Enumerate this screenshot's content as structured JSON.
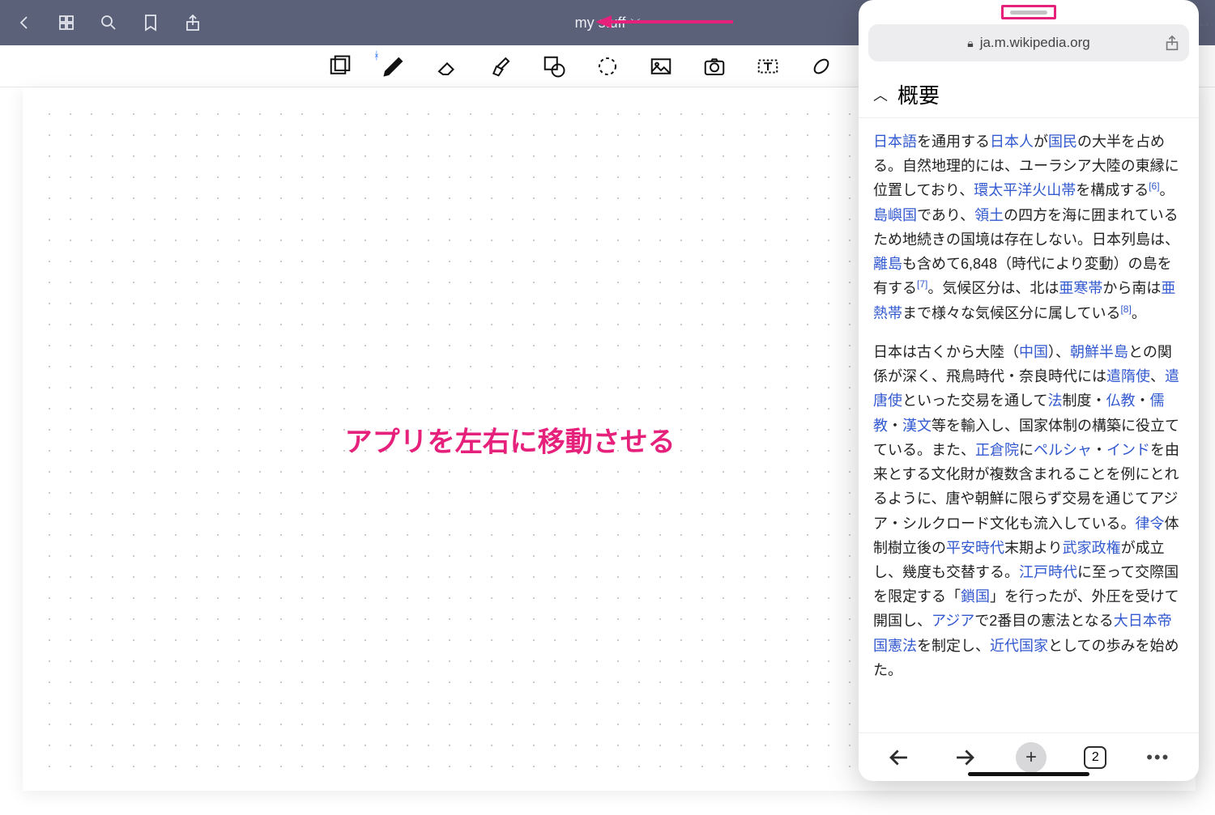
{
  "title": "my stuff",
  "annotation": "アプリを左右に移動させる",
  "slide_over": {
    "url_display": "ja.m.wikipedia.org",
    "section_heading": "概要",
    "tab_count": "2",
    "paragraphs": [
      [
        {
          "t": "日本語",
          "l": true
        },
        {
          "t": "を通用する"
        },
        {
          "t": "日本人",
          "l": true
        },
        {
          "t": "が"
        },
        {
          "t": "国民",
          "l": true
        },
        {
          "t": "の大半を占める。自然地理的には、ユーラシア大陸の東縁に位置しており、"
        },
        {
          "t": "環太平洋火山帯",
          "l": true
        },
        {
          "t": "を構成する"
        },
        {
          "t": "[6]",
          "s": true
        },
        {
          "t": "。"
        },
        {
          "t": "島嶼国",
          "l": true
        },
        {
          "t": "であり、"
        },
        {
          "t": "領土",
          "l": true
        },
        {
          "t": "の四方を海に囲まれているため地続きの国境は存在しない。日本列島は、"
        },
        {
          "t": "離島",
          "l": true
        },
        {
          "t": "も含めて6,848（時代により変動）の島を有する"
        },
        {
          "t": "[7]",
          "s": true
        },
        {
          "t": "。気候区分は、北は"
        },
        {
          "t": "亜寒帯",
          "l": true
        },
        {
          "t": "から南は"
        },
        {
          "t": "亜熱帯",
          "l": true
        },
        {
          "t": "まで様々な気候区分に属している"
        },
        {
          "t": "[8]",
          "s": true
        },
        {
          "t": "。"
        }
      ],
      [
        {
          "t": "日本は古くから大陸（"
        },
        {
          "t": "中国",
          "l": true
        },
        {
          "t": "）、"
        },
        {
          "t": "朝鮮半島",
          "l": true
        },
        {
          "t": "との関係が深く、飛鳥時代・奈良時代には"
        },
        {
          "t": "遣隋使",
          "l": true
        },
        {
          "t": "、"
        },
        {
          "t": "遣唐使",
          "l": true
        },
        {
          "t": "といった交易を通して"
        },
        {
          "t": "法",
          "l": true
        },
        {
          "t": "制度・"
        },
        {
          "t": "仏教",
          "l": true
        },
        {
          "t": "・"
        },
        {
          "t": "儒教",
          "l": true
        },
        {
          "t": "・"
        },
        {
          "t": "漢文",
          "l": true
        },
        {
          "t": "等を輸入し、国家体制の構築に役立てている。また、"
        },
        {
          "t": "正倉院",
          "l": true
        },
        {
          "t": "に"
        },
        {
          "t": "ペルシャ",
          "l": true
        },
        {
          "t": "・"
        },
        {
          "t": "インド",
          "l": true
        },
        {
          "t": "を由来とする文化財が複数含まれることを例にとれるように、唐や朝鮮に限らず交易を通じてアジア・シルクロード文化も流入している。"
        },
        {
          "t": "律令",
          "l": true
        },
        {
          "t": "体制樹立後の"
        },
        {
          "t": "平安時代",
          "l": true
        },
        {
          "t": "末期より"
        },
        {
          "t": "武家政権",
          "l": true
        },
        {
          "t": "が成立し、幾度も交替する。"
        },
        {
          "t": "江戸時代",
          "l": true
        },
        {
          "t": "に至って交際国を限定する「"
        },
        {
          "t": "鎖国",
          "l": true
        },
        {
          "t": "」を行ったが、外圧を受けて開国し、"
        },
        {
          "t": "アジア",
          "l": true
        },
        {
          "t": "で2番目の憲法となる"
        },
        {
          "t": "大日本帝国憲法",
          "l": true
        },
        {
          "t": "を制定し、"
        },
        {
          "t": "近代国家",
          "l": true
        },
        {
          "t": "としての歩みを始めた。"
        }
      ]
    ]
  }
}
